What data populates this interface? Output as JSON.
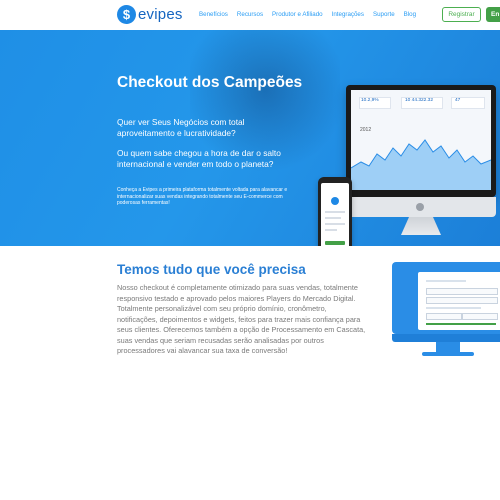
{
  "header": {
    "logo_letter": "$",
    "logo_text": "evipes",
    "nav": [
      "Benefícios",
      "Recursos",
      "Produtor e Afiliado",
      "Integrações",
      "Suporte",
      "Blog"
    ],
    "register_label": "Registrar",
    "enter_label": "En"
  },
  "hero": {
    "title": "Checkout dos Campeões",
    "question1": "Quer ver Seus Negócios com total aproveitamento e lucratividade?",
    "question2": "Ou quem sabe chegou a hora de dar o salto internacional e vender em todo o planeta?",
    "description": "Conheça a Evipes a primeira plataforma totalmente voltada para alavancar e internacionalizar suas vendas integrando totalmente seu E-commerce com poderosas ferramentas!",
    "dashboard": {
      "kpi1": "10.2,9%",
      "kpi2": "10 44.322.32",
      "kpi3": "47",
      "chart_label": "2012"
    }
  },
  "features": {
    "title": "Temos tudo que você precisa",
    "body": "Nosso checkout é completamente otimizado para suas vendas, totalmente responsivo testado e aprovado pelos maiores Players do Mercado Digital. Totalmente personalizável com seu próprio domínio, cronômetro, notificações, depoimentos e widgets, feitos para trazer mais confiança para seus clientes. Oferecemos também a opção de Processamento em Cascata, suas vendas que seriam recusadas serão analisadas por outros processadores vai alavancar sua taxa de conversão!"
  },
  "colors": {
    "brand_blue": "#1e88e5",
    "nav_blue": "#2a9df4",
    "cta_green": "#43a047",
    "heading_blue": "#2a7fd4",
    "body_grey": "#7a7a7a"
  }
}
